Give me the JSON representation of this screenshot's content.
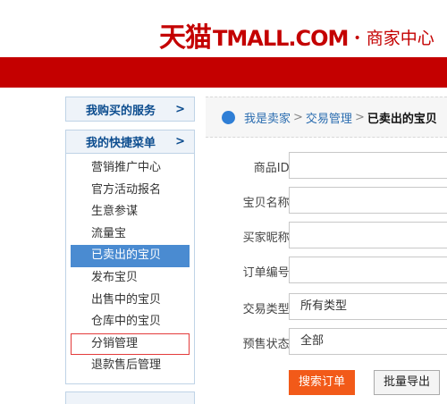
{
  "header": {
    "logo_cn": "天猫",
    "logo_en": "TMALL.COM",
    "logo_dot": "•",
    "logo_sub": "商家中心"
  },
  "sidebar": {
    "services": {
      "title": "我购买的服务",
      "arrow": ">"
    },
    "shortcuts": {
      "title": "我的快捷菜单",
      "arrow": ">",
      "items": [
        {
          "label": "营销推广中心"
        },
        {
          "label": "官方活动报名"
        },
        {
          "label": "生意参谋"
        },
        {
          "label": "流量宝"
        },
        {
          "label": "已卖出的宝贝"
        },
        {
          "label": "发布宝贝"
        },
        {
          "label": "出售中的宝贝"
        },
        {
          "label": "仓库中的宝贝"
        },
        {
          "label": "分销管理"
        },
        {
          "label": "退款售后管理"
        }
      ]
    }
  },
  "breadcrumb": {
    "seller": "我是卖家",
    "sep": ">",
    "trade": "交易管理",
    "current": "已卖出的宝贝"
  },
  "form": {
    "product_id_label": "商品ID:",
    "product_name_label": "宝贝名称:",
    "buyer_nick_label": "买家昵称:",
    "order_no_label": "订单编号:",
    "trade_type_label": "交易类型:",
    "trade_type_value": "所有类型",
    "presale_label": "预售状态:",
    "presale_value": "全部"
  },
  "buttons": {
    "search": "搜索订单",
    "export": "批量导出"
  }
}
